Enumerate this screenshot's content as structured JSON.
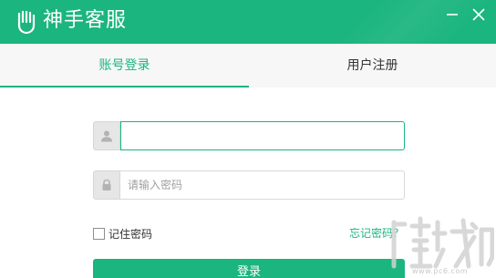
{
  "window": {
    "title": "神手客服",
    "app_icon": "hand-icon",
    "controls": {
      "minimize": "minimize-icon",
      "close": "close-icon"
    },
    "accent_color": "#1bb57f"
  },
  "tabs": [
    {
      "label": "账号登录",
      "active": true
    },
    {
      "label": "用户注册",
      "active": false
    }
  ],
  "form": {
    "username": {
      "value": "",
      "placeholder": "",
      "icon": "user-icon"
    },
    "password": {
      "value": "",
      "placeholder": "请输入密码",
      "icon": "lock-icon"
    },
    "remember_label": "记住密码",
    "remember_checked": false,
    "forgot_label": "忘记密码？",
    "submit_label": "登录"
  },
  "watermark": {
    "logo": "watermark-logo",
    "text": "www.pc6.com"
  }
}
